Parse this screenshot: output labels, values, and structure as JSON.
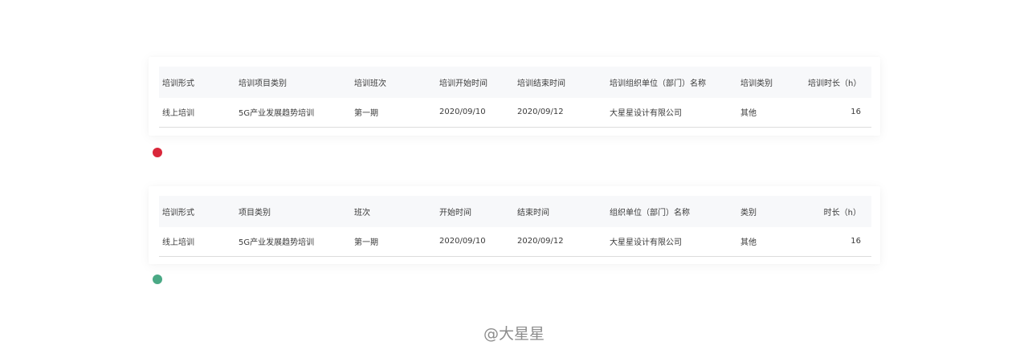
{
  "colors": {
    "dot_bad": "#d9273a",
    "dot_good": "#4aa985"
  },
  "table1": {
    "headers": [
      "培训形式",
      "培训项目类别",
      "培训班次",
      "培训开始时间",
      "培训结束时间",
      "培训组织单位（部门）名称",
      "培训类别",
      "培训时长（h）"
    ],
    "row": [
      "线上培训",
      "5G产业发展趋势培训",
      "第一期",
      "2020/09/10",
      "2020/09/12",
      "大星星设计有限公司",
      "其他",
      "16"
    ]
  },
  "table2": {
    "headers": [
      "培训形式",
      "项目类别",
      "班次",
      "开始时间",
      "结束时间",
      "组织单位（部门）名称",
      "类别",
      "时长（h）"
    ],
    "row": [
      "线上培训",
      "5G产业发展趋势培训",
      "第一期",
      "2020/09/10",
      "2020/09/12",
      "大星星设计有限公司",
      "其他",
      "16"
    ]
  },
  "watermark": "@大星星"
}
